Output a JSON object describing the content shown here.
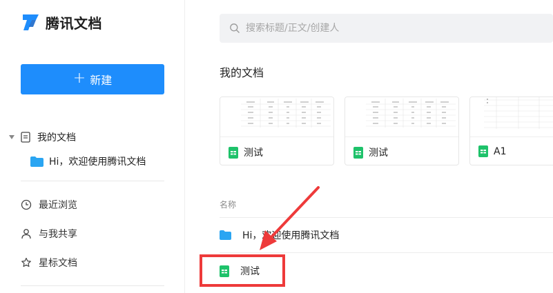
{
  "app": {
    "logo_text": "腾讯文档",
    "logo_color": "#1e8dfc"
  },
  "sidebar": {
    "new_button_icon": "plus-icon",
    "new_button_label": "新建",
    "tree": {
      "my_docs_label": "我的文档",
      "child_label": "Hi，欢迎使用腾讯文档"
    },
    "items": [
      {
        "label": "最近浏览",
        "icon": "clock-icon"
      },
      {
        "label": "与我共享",
        "icon": "user-icon"
      },
      {
        "label": "星标文档",
        "icon": "star-icon"
      }
    ]
  },
  "main": {
    "search": {
      "placeholder": "搜索标题/正文/创建人",
      "icon": "search-icon"
    },
    "section_title": "我的文档",
    "cards": [
      {
        "name": "测试",
        "icon": "sheet-icon"
      },
      {
        "name": "测试",
        "icon": "sheet-icon"
      },
      {
        "name": "A1",
        "icon": "sheet-icon"
      }
    ],
    "list": {
      "header_name": "名称",
      "rows": [
        {
          "name": "Hi，欢迎使用腾讯文档",
          "icon": "folder-icon"
        },
        {
          "name": "测试",
          "icon": "sheet-icon"
        }
      ]
    }
  },
  "colors": {
    "accent": "#1e8dfc",
    "sheet_green": "#1ec26a",
    "folder_blue": "#2aa5f2",
    "annotation_red": "#ee3a3a"
  }
}
